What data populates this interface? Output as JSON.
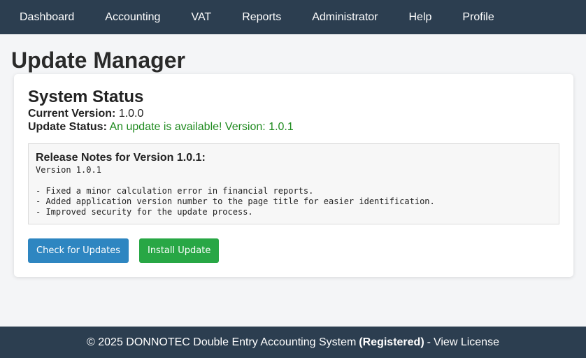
{
  "nav": {
    "items": [
      "Dashboard",
      "Accounting",
      "VAT",
      "Reports",
      "Administrator",
      "Help",
      "Profile"
    ]
  },
  "page": {
    "title": "Update Manager"
  },
  "status": {
    "title": "System Status",
    "current_version_label": "Current Version:",
    "current_version_value": "1.0.0",
    "update_status_label": "Update Status:",
    "update_status_value": "An update is available! Version: 1.0.1",
    "update_status_color": "#1e8a1e"
  },
  "release_notes": {
    "title": "Release Notes for Version 1.0.1:",
    "body": "Version 1.0.1\n\n- Fixed a minor calculation error in financial reports.\n- Added application version number to the page title for easier identification.\n- Improved security for the update process."
  },
  "actions": {
    "check_label": "Check for Updates",
    "install_label": "Install Update",
    "check_color": "#2e86c1",
    "install_color": "#28a745"
  },
  "footer": {
    "prefix": "© 2025 DONNOTEC Double Entry Accounting System",
    "registered": "(Registered)",
    "separator": "-",
    "license_link": "View License"
  }
}
